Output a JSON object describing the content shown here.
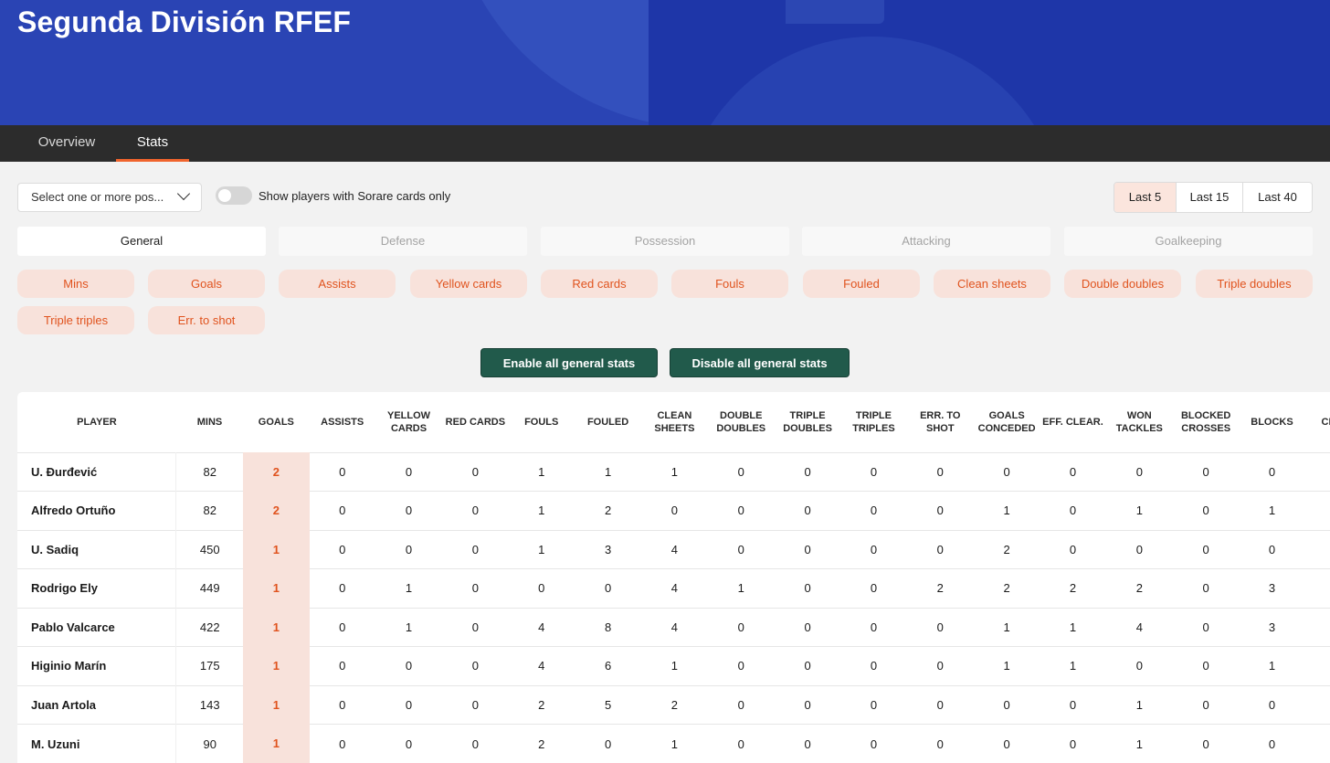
{
  "league_title": "Segunda División RFEF",
  "nav_tabs": [
    "Overview",
    "Stats"
  ],
  "active_tab": "Stats",
  "position_select": {
    "placeholder": "Select one or more pos..."
  },
  "toggle": {
    "label": "Show players with Sorare cards only",
    "on": false
  },
  "ranges": [
    "Last 5",
    "Last 15",
    "Last 40"
  ],
  "active_range": "Last 5",
  "category_tabs": [
    "General",
    "Defense",
    "Possession",
    "Attacking",
    "Goalkeeping"
  ],
  "active_category": "General",
  "stat_chips": [
    "Mins",
    "Goals",
    "Assists",
    "Yellow cards",
    "Red cards",
    "Fouls",
    "Fouled",
    "Clean sheets",
    "Double doubles",
    "Triple doubles",
    "Triple triples",
    "Err. to shot"
  ],
  "buttons": {
    "enable": "Enable all general stats",
    "disable": "Disable all general stats"
  },
  "colors": {
    "accent": "#e0531e",
    "header_blue": "#2a44b4",
    "button_green": "#215a4b",
    "chip_bg": "#f8e2db"
  },
  "table": {
    "columns": [
      "Player",
      "Mins",
      "Goals",
      "Assists",
      "Yellow cards",
      "Red cards",
      "Fouls",
      "Fouled",
      "Clean sheets",
      "Double doubles",
      "Triple doubles",
      "Triple triples",
      "Err. to shot",
      "Goals conceded",
      "Eff. clear.",
      "Won tackles",
      "Blocked crosses",
      "Blocks",
      "Cl"
    ],
    "rows": [
      [
        "U. Đurđević",
        "82",
        "2",
        "0",
        "0",
        "0",
        "1",
        "1",
        "1",
        "0",
        "0",
        "0",
        "0",
        "0",
        "0",
        "0",
        "0",
        "0"
      ],
      [
        "Alfredo Ortuño",
        "82",
        "2",
        "0",
        "0",
        "0",
        "1",
        "2",
        "0",
        "0",
        "0",
        "0",
        "0",
        "1",
        "0",
        "1",
        "0",
        "1"
      ],
      [
        "U. Sadiq",
        "450",
        "1",
        "0",
        "0",
        "0",
        "1",
        "3",
        "4",
        "0",
        "0",
        "0",
        "0",
        "2",
        "0",
        "0",
        "0",
        "0"
      ],
      [
        "Rodrigo Ely",
        "449",
        "1",
        "0",
        "1",
        "0",
        "0",
        "0",
        "4",
        "1",
        "0",
        "0",
        "2",
        "2",
        "2",
        "2",
        "0",
        "3"
      ],
      [
        "Pablo Valcarce",
        "422",
        "1",
        "0",
        "1",
        "0",
        "4",
        "8",
        "4",
        "0",
        "0",
        "0",
        "0",
        "1",
        "1",
        "4",
        "0",
        "3"
      ],
      [
        "Higinio Marín",
        "175",
        "1",
        "0",
        "0",
        "0",
        "4",
        "6",
        "1",
        "0",
        "0",
        "0",
        "0",
        "1",
        "1",
        "0",
        "0",
        "1"
      ],
      [
        "Juan Artola",
        "143",
        "1",
        "0",
        "0",
        "0",
        "2",
        "5",
        "2",
        "0",
        "0",
        "0",
        "0",
        "0",
        "0",
        "1",
        "0",
        "0"
      ],
      [
        "M. Uzuni",
        "90",
        "1",
        "0",
        "0",
        "0",
        "2",
        "0",
        "1",
        "0",
        "0",
        "0",
        "0",
        "0",
        "0",
        "1",
        "0",
        "0"
      ]
    ]
  }
}
